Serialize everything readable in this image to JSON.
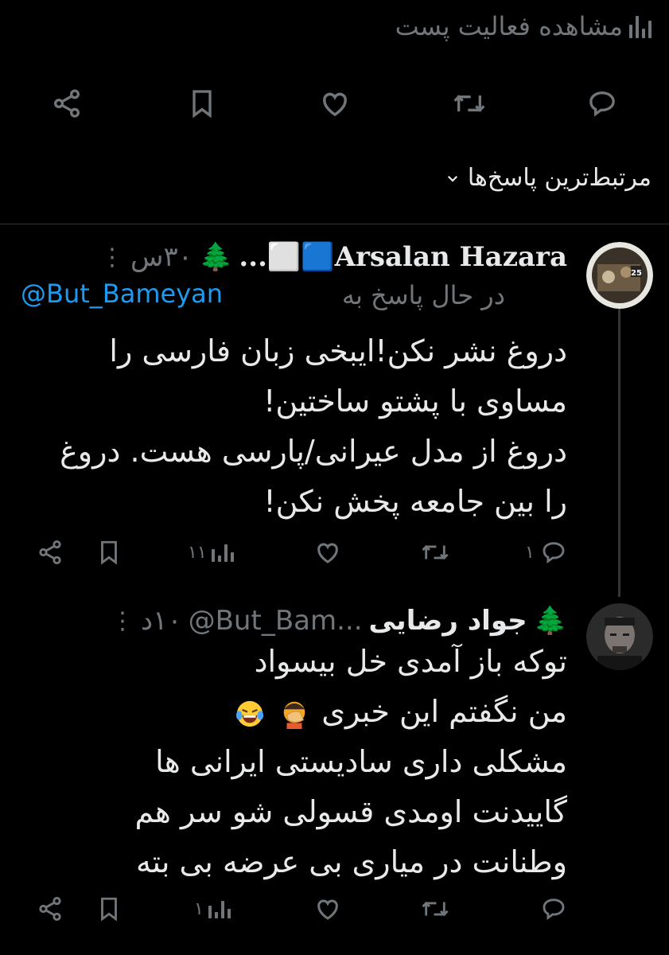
{
  "post_activity": {
    "label": "مشاهده فعالیت پست",
    "icon": "analytics-icon"
  },
  "main_actions": {
    "reply_icon": "reply-icon",
    "retweet_icon": "retweet-icon",
    "like_icon": "like-icon",
    "bookmark_icon": "bookmark-icon",
    "share_icon": "share-icon"
  },
  "sort": {
    "label": "مرتبط‌ترین پاسخ‌ها",
    "icon": "chevron-down-icon"
  },
  "replies": [
    {
      "name": "Arsalan Hazara🟦⬜...",
      "tree_emoji": "🌲",
      "time": "۳۰س",
      "replying_prefix": "در حال پاسخ به",
      "replying_to": "@But_Bameyan",
      "text_lines": [
        "دروغ نشر نکن!ایبخی زبان فارسی را",
        "مساوی با پشتو ساختین!",
        "دروغ از مدل عیرانی/پارسی هست. دروغ",
        "را بین جامعه پخش نکن!"
      ],
      "reply_count": "۱",
      "retweet_count": "",
      "like_count": "",
      "views_count": "۱۱"
    },
    {
      "name": "جواد رضایی",
      "tree_emoji": "🌲",
      "handle": "@But_Bam...",
      "time": "۱۰د",
      "text_lines": [
        "توکه باز آمدی خل بیسواد",
        "من نگفتم این خبری",
        "مشکلی داری  سادیستی ایرانی ها",
        "گاییدنت اومدی قسولی شو سر هم",
        "وطنانت در میاری بی عرضه بی بته"
      ],
      "emojis": [
        "facepalm-emoji",
        "laughing-emoji"
      ],
      "reply_count": "",
      "retweet_count": "",
      "like_count": "",
      "views_count": "۱"
    }
  ],
  "colors": {
    "background": "#000000",
    "text": "#e7e9ea",
    "muted": "#71767b",
    "link": "#1d9bf0",
    "separator": "#2f3336"
  }
}
